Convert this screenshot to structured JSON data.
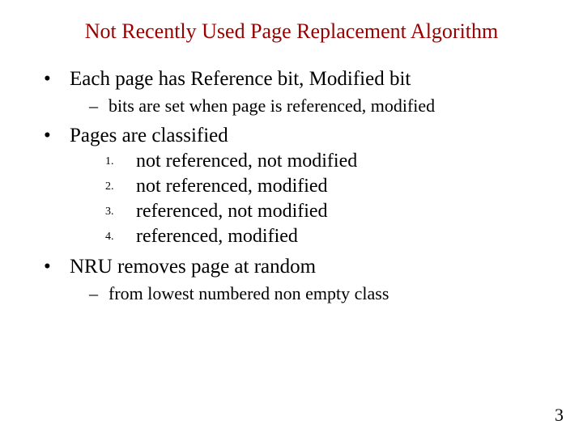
{
  "title": "Not Recently Used Page Replacement Algorithm",
  "bullets": [
    {
      "text": "Each page has Reference bit, Modified bit",
      "sub": [
        "bits are set when page is referenced, modified"
      ]
    },
    {
      "text": "Pages are classified",
      "numbered": [
        "not referenced, not modified",
        "not referenced, modified",
        "referenced, not modified",
        "referenced, modified"
      ]
    },
    {
      "text": "NRU removes page at random",
      "sub": [
        "from lowest numbered non empty class"
      ]
    }
  ],
  "page_number": "3"
}
